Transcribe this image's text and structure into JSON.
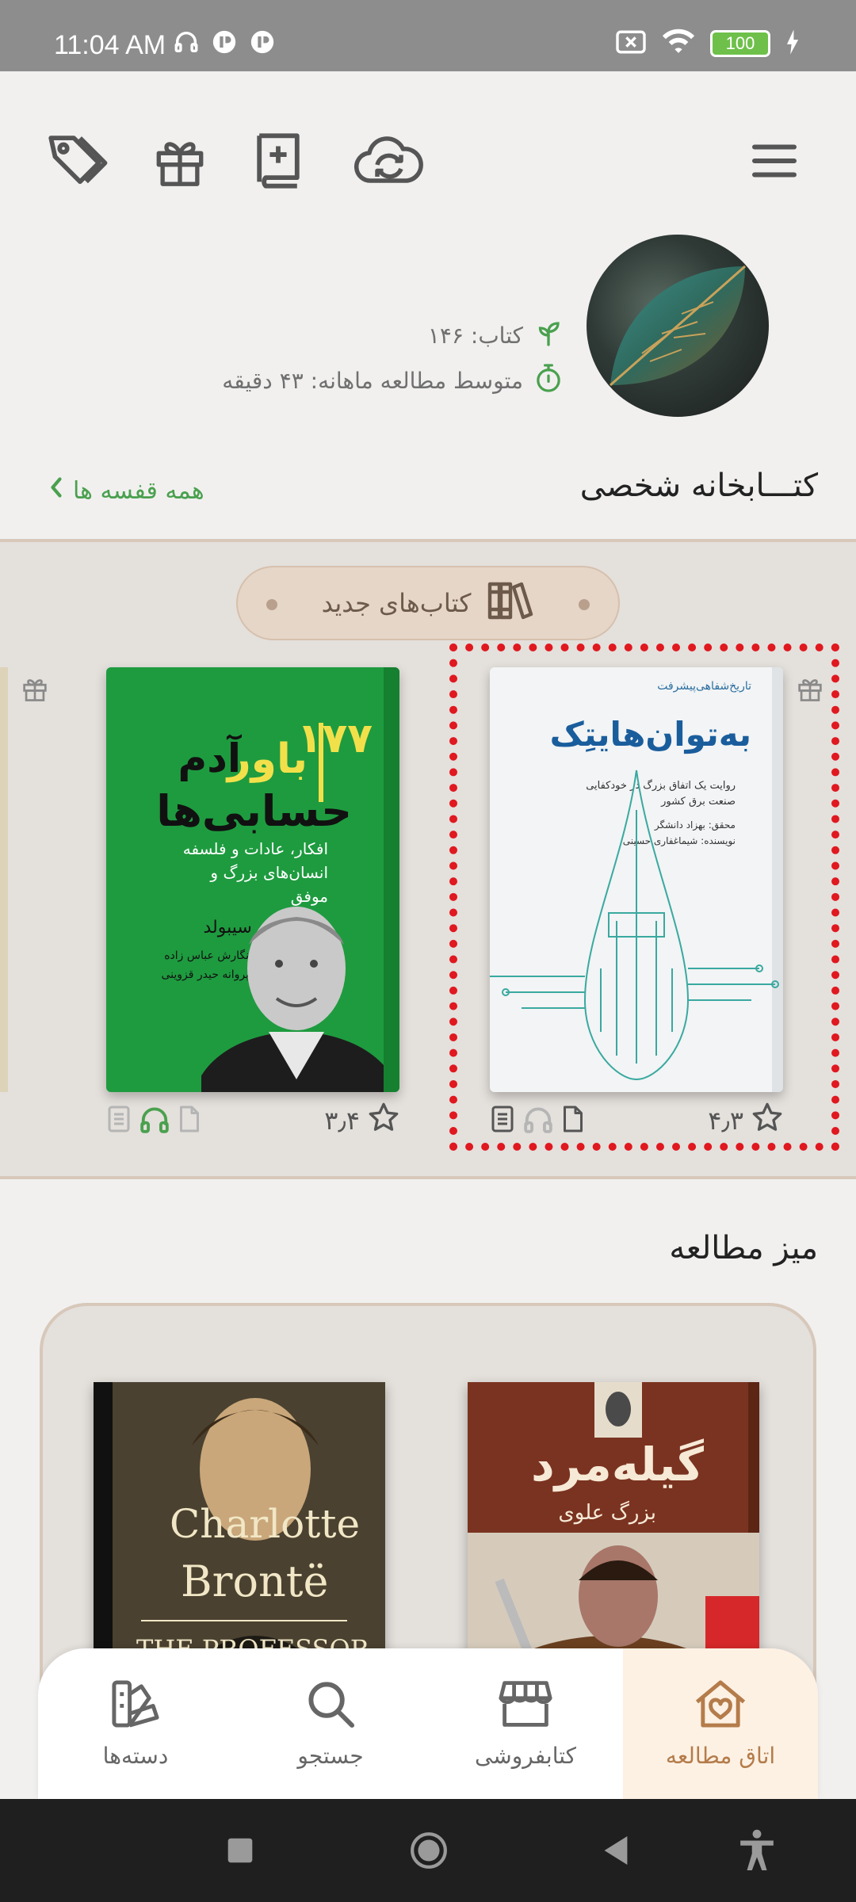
{
  "status_bar": {
    "time": "11:04 AM",
    "battery": "100",
    "icons_left": [
      "headphones-icon",
      "vpn-icon",
      "vpn-icon"
    ],
    "icons_right": [
      "sim-icon",
      "wifi-icon",
      "battery-icon",
      "charging-icon"
    ]
  },
  "toolbar": {
    "icons": [
      "tag-icon",
      "gift-icon",
      "add-book-icon",
      "cloud-sync-icon",
      "menu-icon"
    ]
  },
  "profile": {
    "books_label": "کتاب: ۱۴۶",
    "monthly_reading": "متوسط مطالعه ماهانه: ۴۳ دقیقه"
  },
  "library": {
    "title": "کتـــابخانه شخصی",
    "all_shelves": "همه قفسه ها",
    "shelf_name": "کتاب‌های جدید",
    "books": [
      {
        "cover_title": "به‌توان‌هایتِک",
        "cover_series": "تاریخ‌شفاهی‌پیشرفت",
        "cover_subtitle": "روایت یک اتفاق بزرگ در خودکفایی صنعت برق کشور",
        "cover_author": "محقق: بهزاد دانشگر",
        "cover_writer": "نویسنده: شیماغفاری حسینی",
        "rating": "۴٫۳",
        "accent": "#3a6ea5"
      },
      {
        "cover_number": "۱۷۷",
        "cover_title_1": "باور",
        "cover_title_2": "آدم",
        "cover_title_3": "حسابی‌ها",
        "cover_subtitle": "افکار، عادات و فلسفه انسان‌های بزرگ و موفق",
        "cover_author": "استیو سیبولد",
        "cover_translator_1": "نگارش عباس زاده",
        "cover_translator_2": "پروانه حیدر قزوینی",
        "rating": "۳٫۴",
        "accent": "#1e9b3f"
      }
    ]
  },
  "desk": {
    "title": "میز مطالعه",
    "books": [
      {
        "cover_title": "گیله‌مرد",
        "cover_author": "بزرگ علوی"
      },
      {
        "cover_line_1": "Charlotte",
        "cover_line_2": "Brontë",
        "cover_line_3": "THE PROFESSOR"
      }
    ]
  },
  "bottom_nav": {
    "items": [
      {
        "label": "اتاق مطالعه",
        "icon": "home-heart-icon"
      },
      {
        "label": "کتابفروشی",
        "icon": "store-icon"
      },
      {
        "label": "جستجو",
        "icon": "search-icon"
      },
      {
        "label": "دسته‌ها",
        "icon": "categories-icon"
      }
    ]
  },
  "colors": {
    "accent_green": "#4aa04e",
    "nav_active": "#b47c4a",
    "highlight": "#e0181f"
  }
}
